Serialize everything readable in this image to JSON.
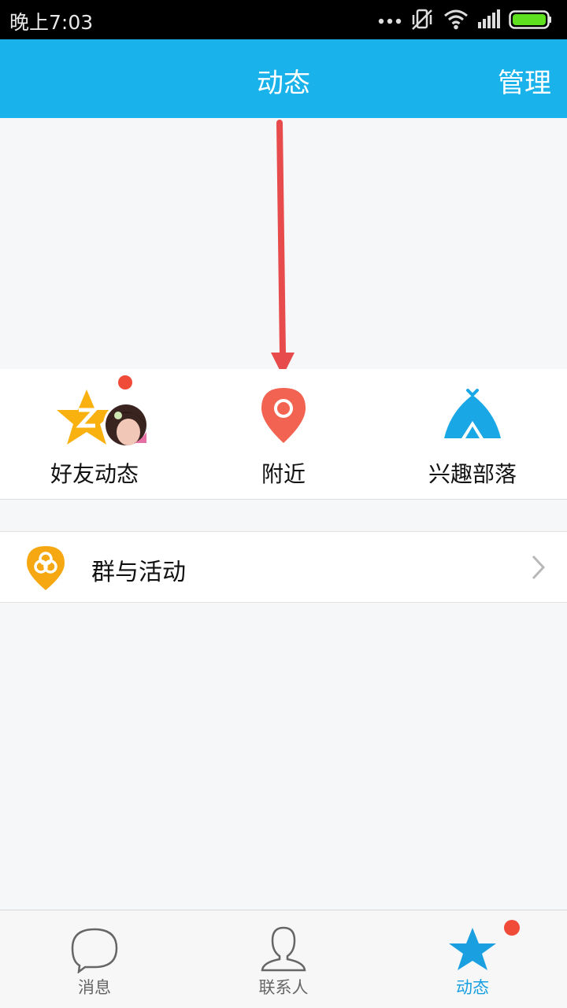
{
  "status_bar": {
    "time": "晚上7:03",
    "icons": [
      "more-dots-icon",
      "vibrate-off-icon",
      "wifi-icon",
      "signal-icon",
      "battery-icon"
    ]
  },
  "header": {
    "title": "动态",
    "action": "管理",
    "bg_color": "#19b2eb"
  },
  "features": [
    {
      "label": "好友动态",
      "icon": "qzone-star-icon",
      "badge": true
    },
    {
      "label": "附近",
      "icon": "location-pin-icon",
      "badge": false
    },
    {
      "label": "兴趣部落",
      "icon": "tent-icon",
      "badge": false
    }
  ],
  "list": [
    {
      "label": "群与活动",
      "icon": "group-pin-icon"
    }
  ],
  "tabs": [
    {
      "label": "消息",
      "icon": "chat-bubble-icon",
      "active": false
    },
    {
      "label": "联系人",
      "icon": "contact-person-icon",
      "active": false
    },
    {
      "label": "动态",
      "icon": "star-icon",
      "active": true,
      "badge": true
    }
  ],
  "colors": {
    "accent": "#19b2eb",
    "badge": "#f04a38",
    "pin": "#f26451",
    "tent": "#1aa7e6",
    "group_icon": "#f5a812"
  }
}
